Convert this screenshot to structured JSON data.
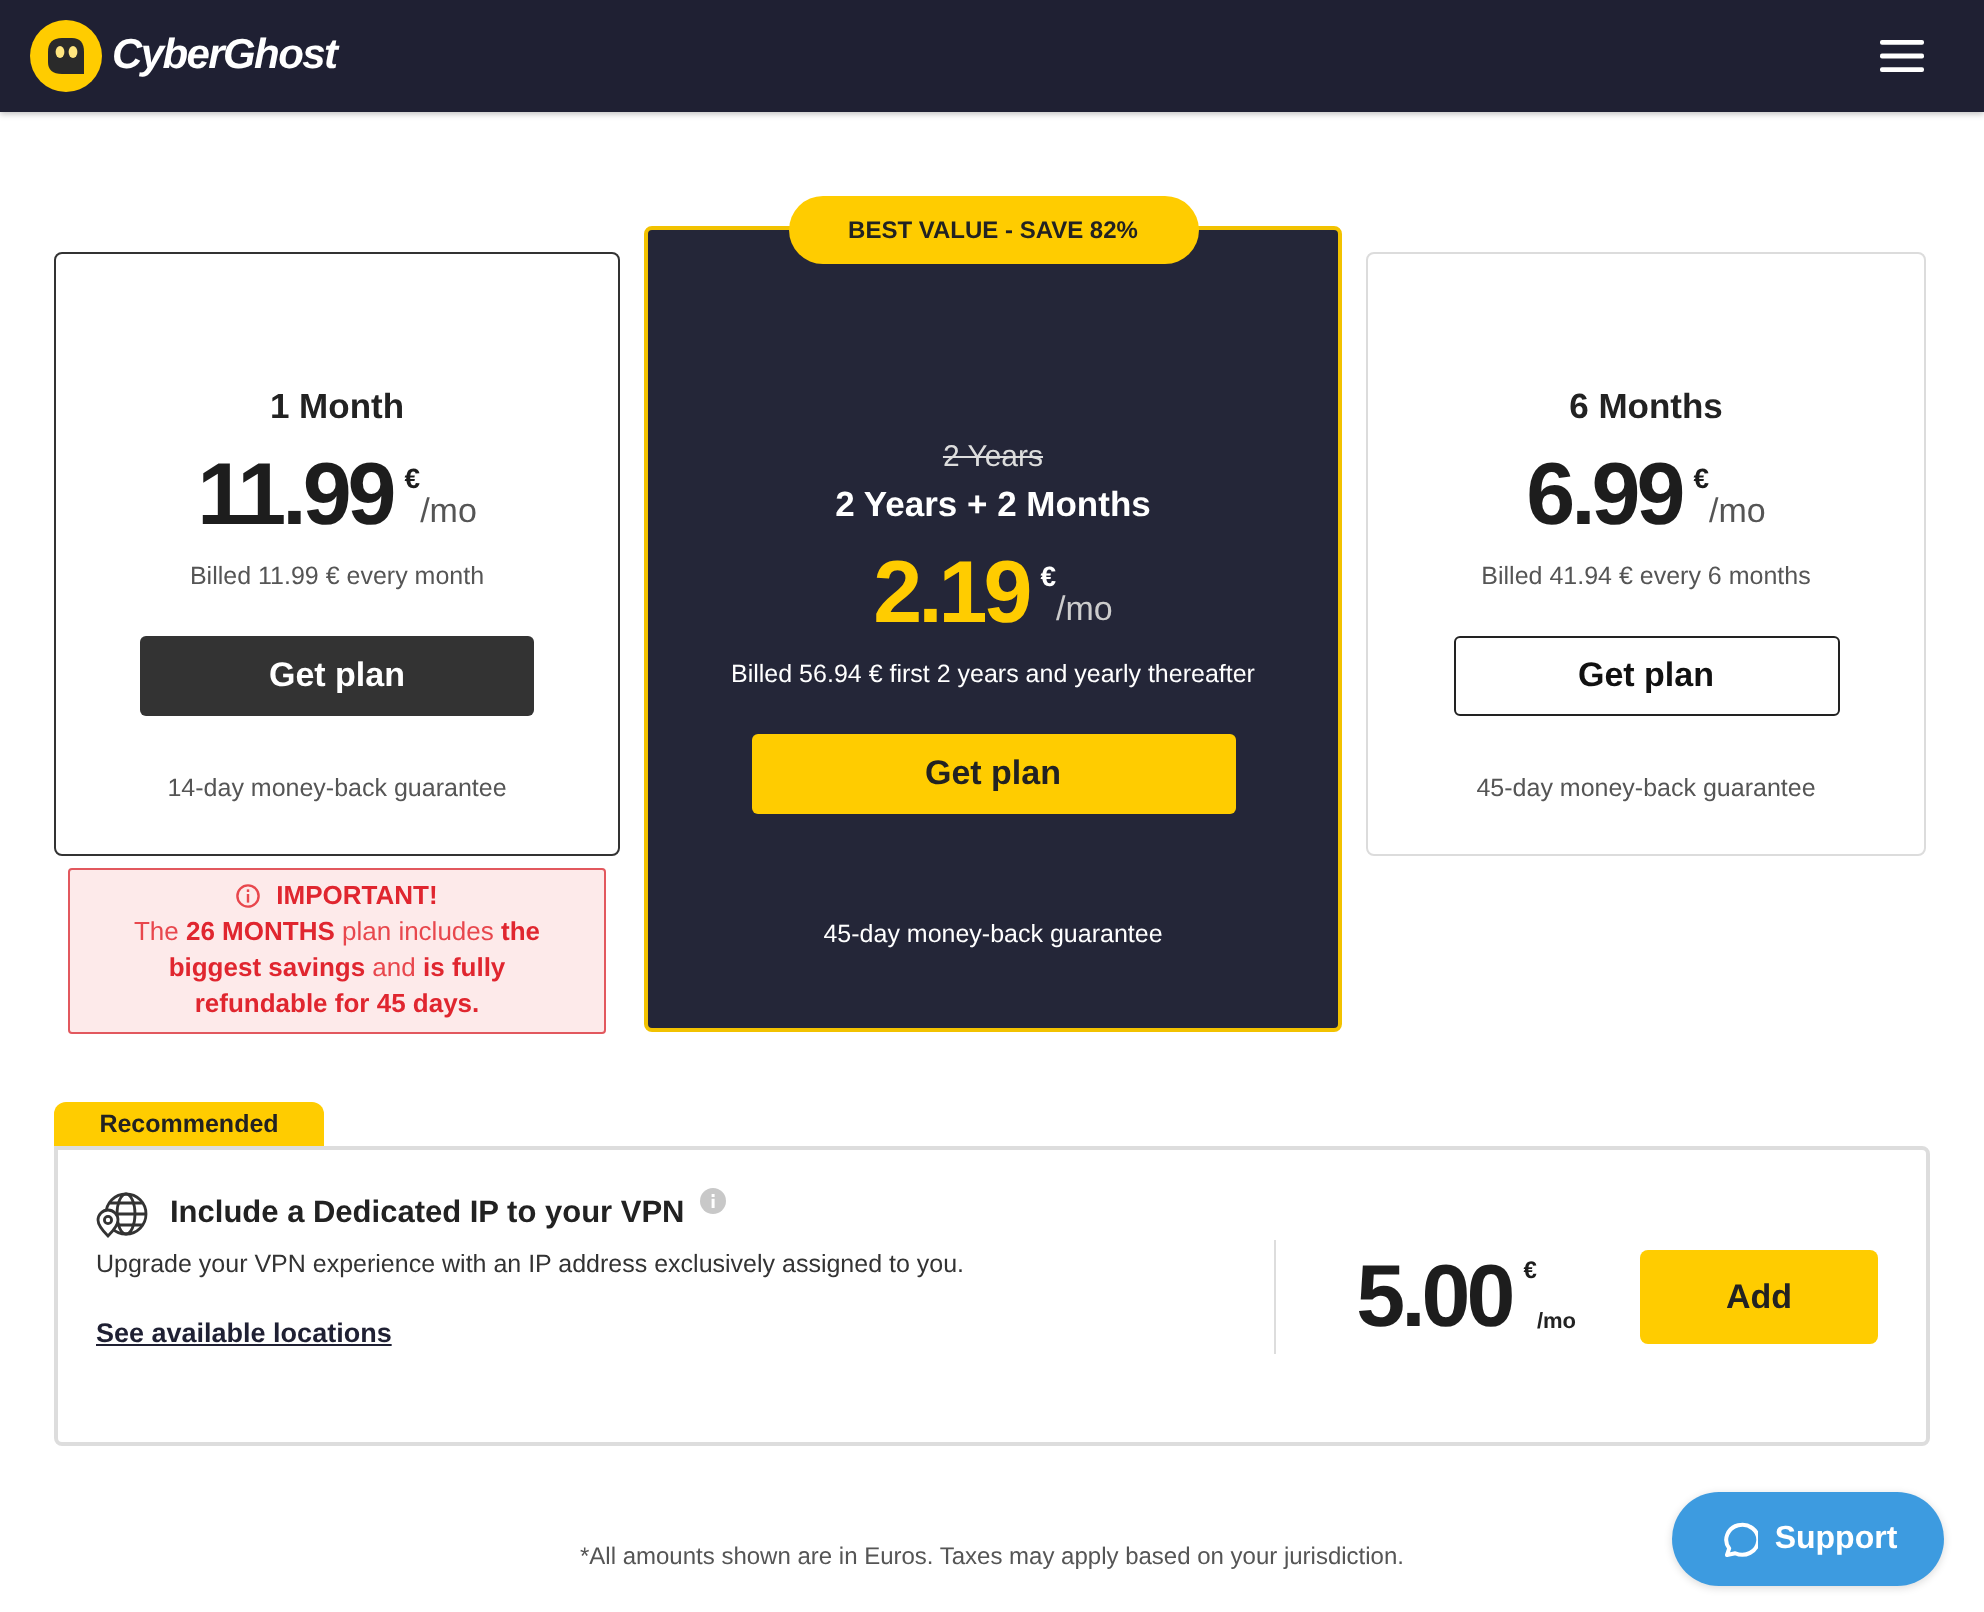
{
  "header": {
    "brand": "CyberGhost"
  },
  "plans": [
    {
      "kind": "solid",
      "title": "1 Month",
      "price": "11.99",
      "currency": "€",
      "period": "/mo",
      "billing": "Billed 11.99 € every month",
      "button": "Get plan",
      "guarantee": "14-day money-back guarantee",
      "notice": {
        "heading": "IMPORTANT!",
        "text": "The **26 MONTHS** plan includes **the biggest savings** and **is fully refundable for 45 days.**"
      }
    },
    {
      "kind": "featured",
      "badge": "BEST VALUE - SAVE 82%",
      "old_title": "2 Years",
      "title": "2 Years + 2 Months",
      "price": "2.19",
      "currency": "€",
      "period": "/mo",
      "billing": "Billed 56.94 € first 2 years and yearly thereafter",
      "button": "Get plan",
      "guarantee": "45-day money-back guarantee"
    },
    {
      "kind": "outline",
      "title": "6 Months",
      "price": "6.99",
      "currency": "€",
      "period": "/mo",
      "billing": "Billed 41.94 € every 6 months",
      "button": "Get plan",
      "guarantee": "45-day money-back guarantee"
    }
  ],
  "addon": {
    "tab": "Recommended",
    "title": "Include a Dedicated IP to your VPN",
    "description": "Upgrade your VPN experience with an IP address exclusively assigned to you.",
    "link": "See available locations",
    "price": "5.00",
    "currency": "€",
    "period": "/mo",
    "button": "Add"
  },
  "footnote": "*All amounts shown are in Euros. Taxes may apply based on your jurisdiction.",
  "support": {
    "label": "Support"
  }
}
